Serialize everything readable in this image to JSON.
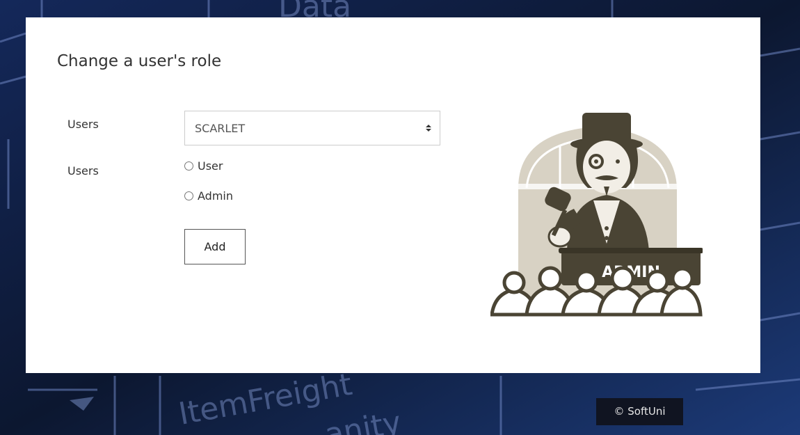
{
  "page": {
    "title": "Change a user's role"
  },
  "form": {
    "users_label": "Users",
    "role_label": "Users",
    "user_select": {
      "selected": "SCARLET"
    },
    "roles": [
      {
        "label": "User",
        "checked": false
      },
      {
        "label": "Admin",
        "checked": false
      }
    ],
    "add_button": "Add"
  },
  "logo": {
    "text": "ADMIN",
    "icon": "auctioneer-admin-logo"
  },
  "background": {
    "decorative_text": [
      "Data",
      "ItemFreight",
      "anity"
    ]
  },
  "footer": {
    "copyright": "© SoftUni"
  },
  "colors": {
    "card_background": "#ffffff",
    "logo_dark": "#4a4434",
    "logo_light": "#d8d2c4",
    "background_dark": "#0f1b3d"
  }
}
